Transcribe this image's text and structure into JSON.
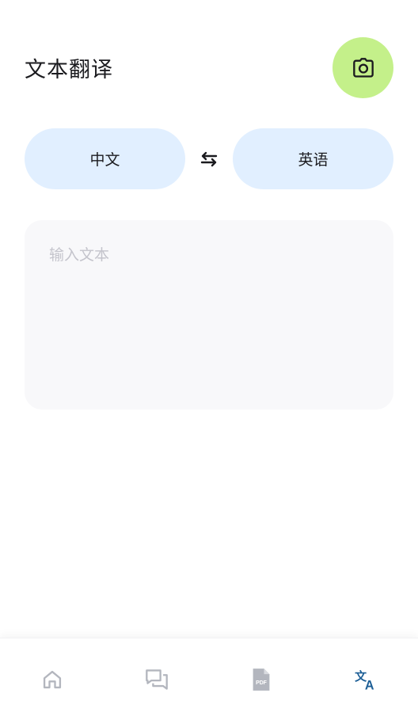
{
  "header": {
    "title": "文本翻译",
    "camera_icon": "camera-icon"
  },
  "languages": {
    "source": "中文",
    "target": "英语",
    "swap_icon": "swap-arrows-icon"
  },
  "input": {
    "placeholder": "输入文本",
    "value": ""
  },
  "bottom_nav": {
    "items": [
      {
        "icon": "home-icon",
        "active": false
      },
      {
        "icon": "chat-icon",
        "active": false
      },
      {
        "icon": "pdf-icon",
        "active": false
      },
      {
        "icon": "translate-icon",
        "active": true
      }
    ]
  },
  "colors": {
    "camera_bg": "#c4f08a",
    "lang_pill_bg": "#e1efff",
    "input_bg": "#f8f8fa",
    "nav_inactive": "#b3b6be",
    "nav_active": "#1d5f96"
  }
}
